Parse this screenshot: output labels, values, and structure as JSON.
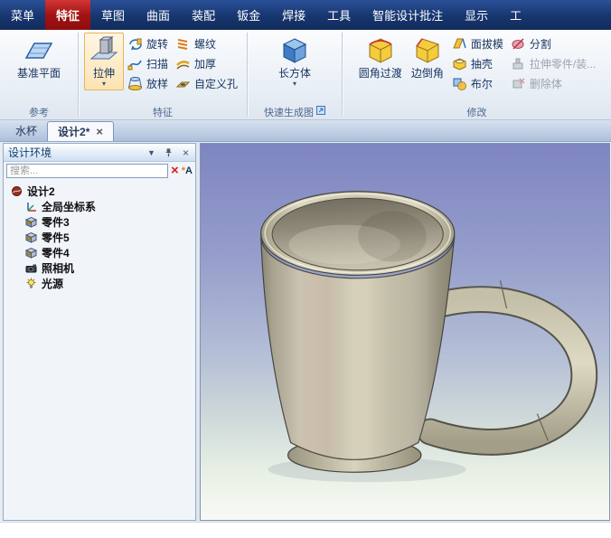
{
  "menubar": {
    "tabs": [
      {
        "label": "菜单"
      },
      {
        "label": "特征"
      },
      {
        "label": "草图"
      },
      {
        "label": "曲面"
      },
      {
        "label": "装配"
      },
      {
        "label": "钣金"
      },
      {
        "label": "焊接"
      },
      {
        "label": "工具"
      },
      {
        "label": "智能设计批注"
      },
      {
        "label": "显示"
      },
      {
        "label": "工"
      }
    ],
    "active_tab": "特征"
  },
  "ribbon": {
    "groups": {
      "reference": {
        "label": "参考",
        "datum_plane": "基准平面"
      },
      "feature": {
        "label": "特征",
        "extrude": "拉伸",
        "revolve": "旋转",
        "sweep": "扫描",
        "loft": "放样",
        "thread": "螺纹",
        "thicken": "加厚",
        "custom_hole": "自定义孔"
      },
      "quick": {
        "label": "快速生成图",
        "box": "长方体"
      },
      "modify": {
        "label": "修改",
        "fillet": "圆角过渡",
        "chamfer": "边倒角",
        "draft": "面拔模",
        "shell": "抽壳",
        "boolean": "布尔",
        "split": "分割",
        "extrude_part": "拉伸零件/装...",
        "delete_body": "删除体"
      }
    }
  },
  "doc_tabs": [
    {
      "label": "水杯",
      "active": false
    },
    {
      "label": "设计2*",
      "active": true
    }
  ],
  "panel": {
    "title": "设计环境",
    "search_placeholder": "搜索...",
    "tree": [
      {
        "label": "设计2"
      },
      {
        "label": "全局坐标系"
      },
      {
        "label": "零件3"
      },
      {
        "label": "零件5"
      },
      {
        "label": "零件4"
      },
      {
        "label": "照相机"
      },
      {
        "label": "光源"
      }
    ]
  },
  "icons": {
    "dropdown": "▾",
    "close": "×",
    "clear_search": "×",
    "panel_menu": "▼",
    "star": "*",
    "letter_a": "A"
  },
  "colors": {
    "menubar_blue": "#17366f",
    "active_tab_red": "#a31313",
    "mug_body": "#cdc7b1",
    "viewport_top": "#7e85c1",
    "viewport_bottom": "#f7faf4"
  }
}
